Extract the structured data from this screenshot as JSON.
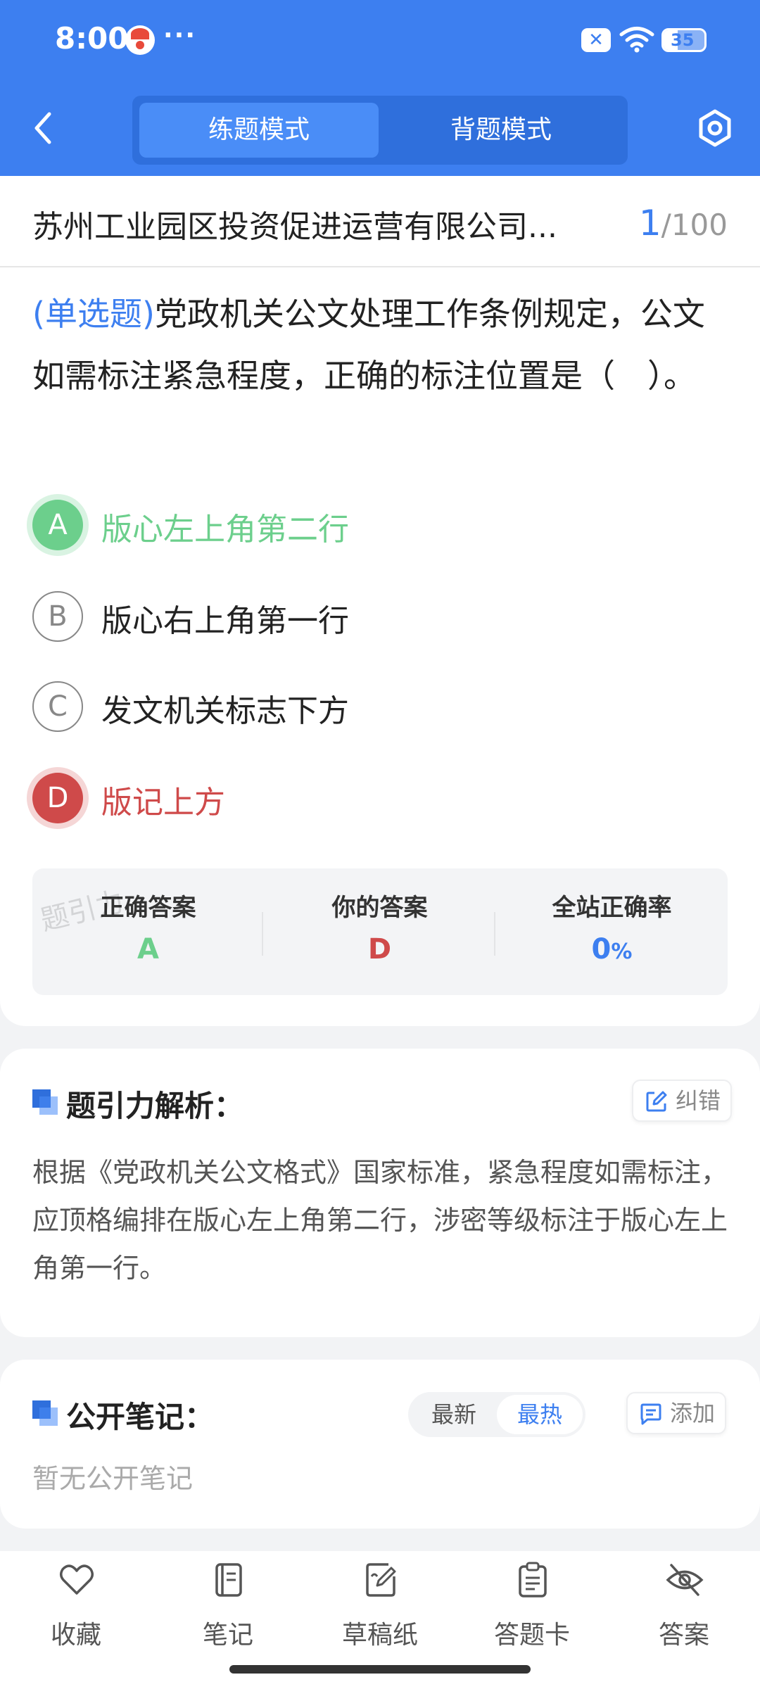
{
  "status_bar": {
    "time": "8:00",
    "dots": "···",
    "x_badge": "✕",
    "battery": "35",
    "battery_level": 0.35
  },
  "header": {
    "tabs": [
      {
        "label": "练题模式",
        "active": true
      },
      {
        "label": "背题模式",
        "active": false
      }
    ]
  },
  "exam": {
    "title": "苏州工业园区投资促进运营有限公司...",
    "current": "1",
    "total": "/100"
  },
  "question": {
    "type": "(单选题)",
    "text": "党政机关公文处理工作条例规定，公文如需标注紧急程度，正确的标注位置是（　）。"
  },
  "options": [
    {
      "letter": "A",
      "text": "版心左上角第二行",
      "state": "correct"
    },
    {
      "letter": "B",
      "text": "版心右上角第一行",
      "state": "normal"
    },
    {
      "letter": "C",
      "text": "发文机关标志下方",
      "state": "normal"
    },
    {
      "letter": "D",
      "text": "版记上方",
      "state": "wrong"
    }
  ],
  "answer": {
    "correct_label": "正确答案",
    "correct_value": "A",
    "yours_label": "你的答案",
    "yours_value": "D",
    "rate_label": "全站正确率",
    "rate_value": "0",
    "rate_unit": "%"
  },
  "watermark": "题引力",
  "analysis": {
    "title": "题引力解析：",
    "report_label": "纠错",
    "text": "根据《党政机关公文格式》国家标准，紧急程度如需标注，应顶格编排在版心左上角第二行，涉密等级标注于版心左上角第一行。"
  },
  "notes": {
    "title": "公开笔记：",
    "sort_latest": "最新",
    "sort_hot": "最热",
    "add_label": "添加",
    "empty": "暂无公开笔记"
  },
  "toolbar": {
    "items": [
      "收藏",
      "笔记",
      "草稿纸",
      "答题卡",
      "答案"
    ]
  },
  "colors": {
    "primary": "#3d7ff0",
    "correct": "#6ccf8c",
    "wrong": "#cf4a4a"
  }
}
